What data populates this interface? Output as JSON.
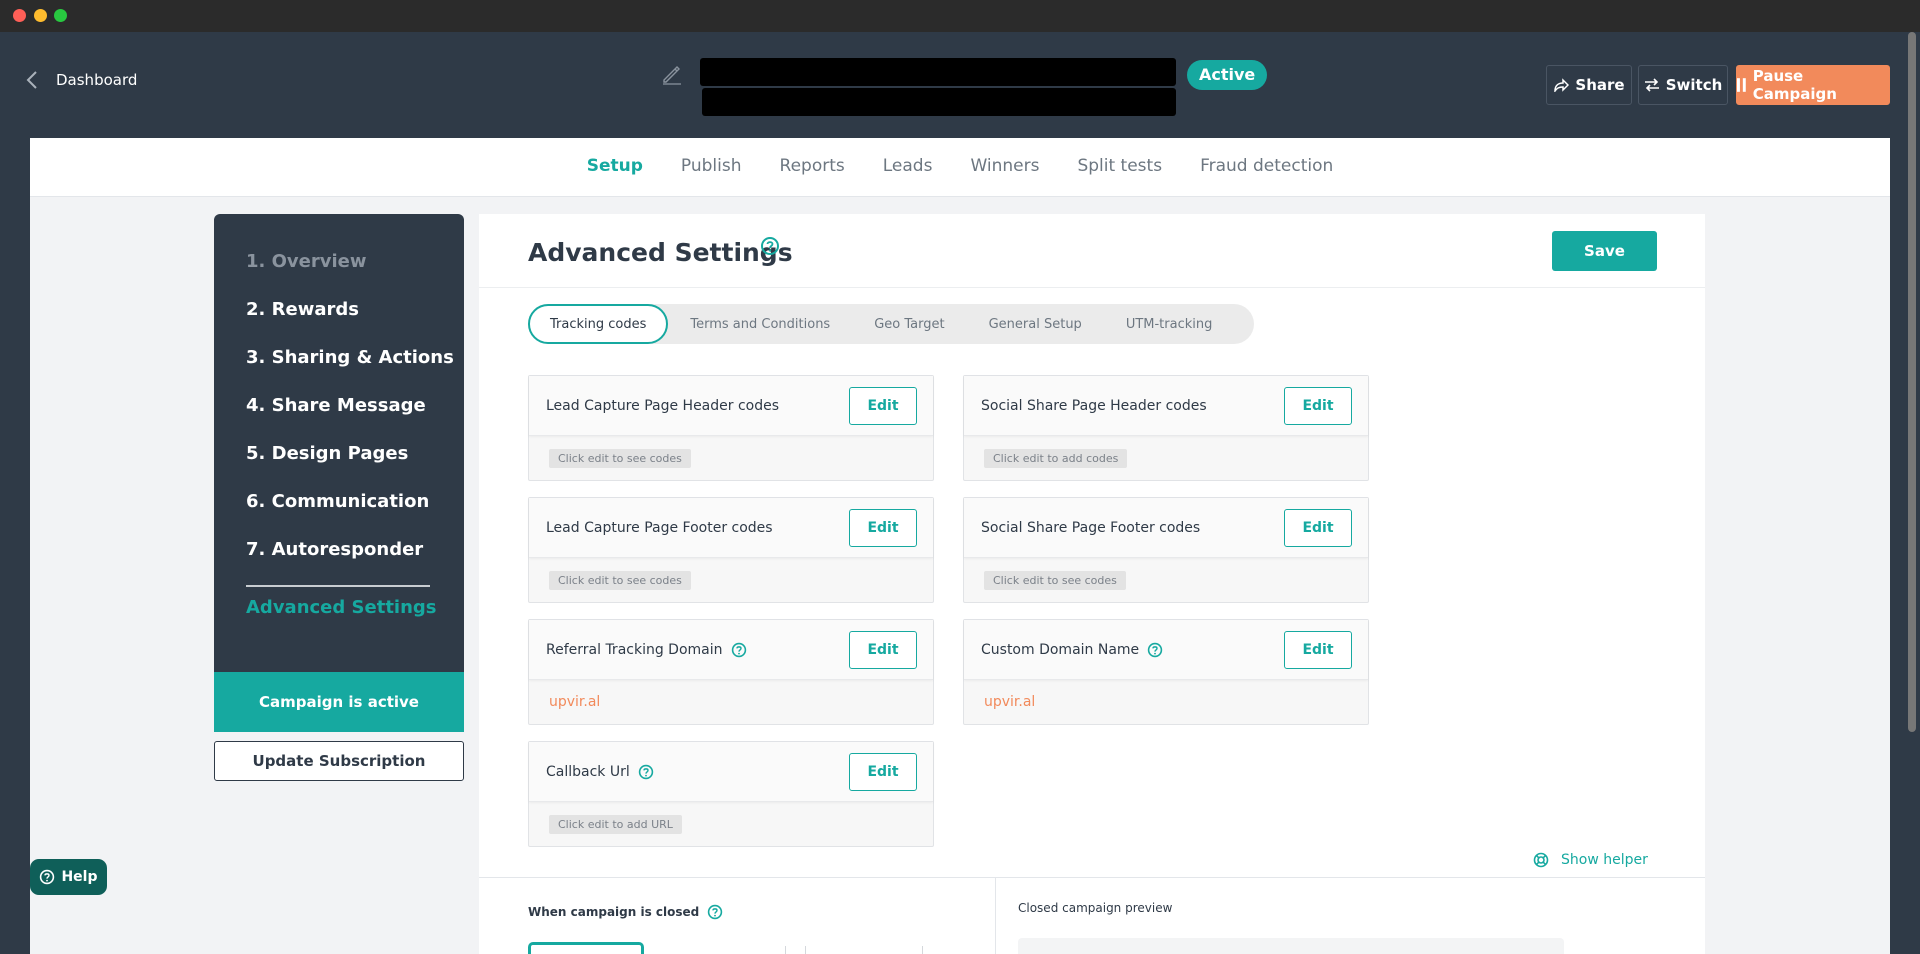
{
  "header": {
    "back_label": "Dashboard",
    "status_badge": "Active",
    "share_label": "Share",
    "switch_label": "Switch",
    "pause_label": "Pause Campaign"
  },
  "nav": {
    "tabs": [
      {
        "label": "Setup",
        "active": true
      },
      {
        "label": "Publish"
      },
      {
        "label": "Reports"
      },
      {
        "label": "Leads"
      },
      {
        "label": "Winners"
      },
      {
        "label": "Split tests"
      },
      {
        "label": "Fraud detection"
      }
    ]
  },
  "sidebar": {
    "steps": [
      {
        "label": "1. Overview"
      },
      {
        "label": "2. Rewards"
      },
      {
        "label": "3. Sharing & Actions"
      },
      {
        "label": "4. Share Message"
      },
      {
        "label": "5. Design Pages"
      },
      {
        "label": "6. Communication"
      },
      {
        "label": "7. Autoresponder"
      }
    ],
    "current_label": "Advanced Settings",
    "status_text": "Campaign is active",
    "update_button": "Update Subscription"
  },
  "main": {
    "title": "Advanced Settings",
    "save_label": "Save",
    "subtabs": [
      {
        "label": "Tracking codes",
        "active": true
      },
      {
        "label": "Terms and Conditions"
      },
      {
        "label": "Geo Target"
      },
      {
        "label": "General Setup"
      },
      {
        "label": "UTM-tracking"
      }
    ],
    "cards": [
      {
        "title": "Lead Capture Page Header codes",
        "edit": "Edit",
        "value": "Click edit to see codes"
      },
      {
        "title": "Social Share Page Header codes",
        "edit": "Edit",
        "value": "Click edit to add codes"
      },
      {
        "title": "Lead Capture Page Footer codes",
        "edit": "Edit",
        "value": "Click edit to see codes"
      },
      {
        "title": "Social Share Page Footer codes",
        "edit": "Edit",
        "value": "Click edit to see codes"
      },
      {
        "title": "Referral Tracking Domain",
        "edit": "Edit",
        "value": "upvir.al"
      },
      {
        "title": "Custom Domain Name",
        "edit": "Edit",
        "value": "upvir.al"
      },
      {
        "title": "Callback Url",
        "edit": "Edit",
        "value": "Click edit to add URL"
      }
    ],
    "show_helper": "Show helper",
    "closed_label": "When campaign is closed",
    "preview_label": "Closed campaign preview"
  },
  "help_label": "Help",
  "colors": {
    "accent": "#16a9a0",
    "pause": "#f28a5b",
    "dark": "#2f3a47"
  }
}
